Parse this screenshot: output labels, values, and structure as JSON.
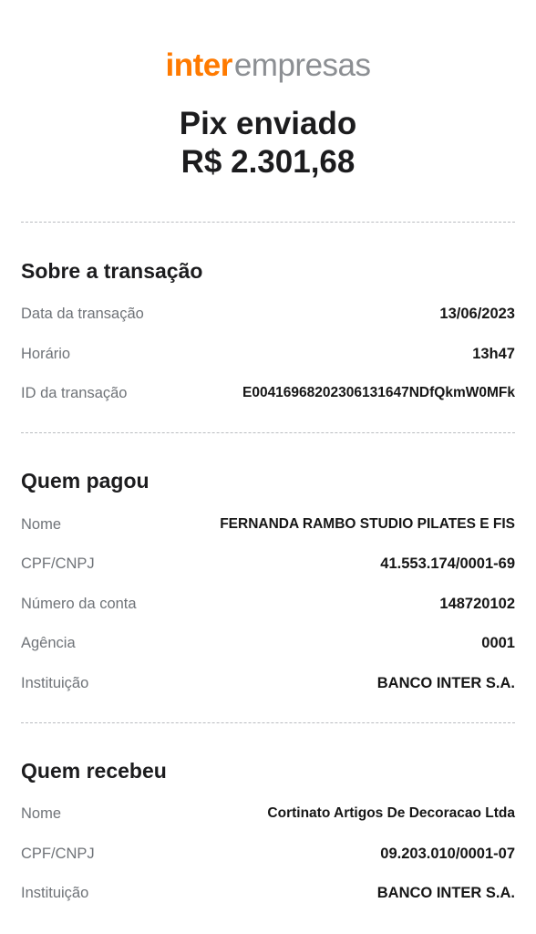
{
  "header": {
    "brand": "inter",
    "brand_sub": "empresas",
    "title": "Pix enviado",
    "amount": "R$ 2.301,68"
  },
  "colors": {
    "brand_orange": "#ff7a00",
    "brand_gray": "#8c8f93",
    "label_gray": "#6f7378",
    "text_dark": "#161616",
    "divider": "#b9bcc0"
  },
  "transaction": {
    "title": "Sobre a transação",
    "rows": [
      {
        "label": "Data da transação",
        "value": "13/06/2023"
      },
      {
        "label": "Horário",
        "value": "13h47"
      },
      {
        "label": "ID da transação",
        "value": "E00416968202306131647NDfQkmW0MFk"
      }
    ]
  },
  "payer": {
    "title": "Quem pagou",
    "rows": [
      {
        "label": "Nome",
        "value": "FERNANDA RAMBO STUDIO PILATES E FIS"
      },
      {
        "label": "CPF/CNPJ",
        "value": "41.553.174/0001-69"
      },
      {
        "label": "Número da conta",
        "value": "148720102"
      },
      {
        "label": "Agência",
        "value": "0001"
      },
      {
        "label": "Instituição",
        "value": "BANCO INTER S.A."
      }
    ]
  },
  "receiver": {
    "title": "Quem recebeu",
    "rows": [
      {
        "label": "Nome",
        "value": "Cortinato Artigos De Decoracao Ltda"
      },
      {
        "label": "CPF/CNPJ",
        "value": "09.203.010/0001-07"
      },
      {
        "label": "Instituição",
        "value": "BANCO INTER S.A."
      }
    ]
  }
}
